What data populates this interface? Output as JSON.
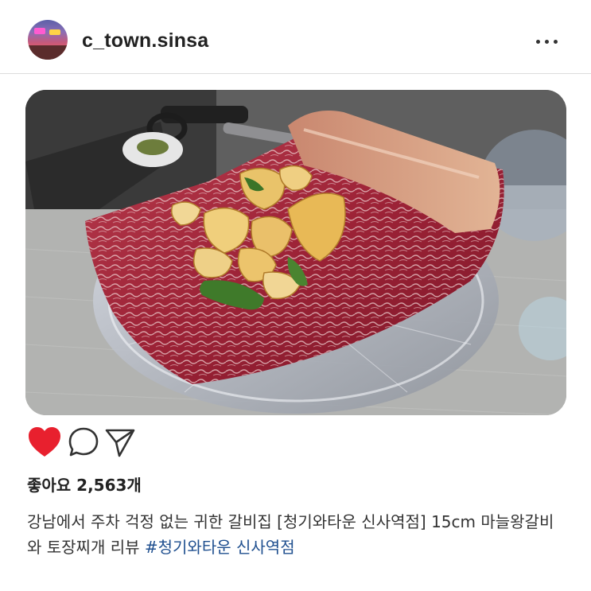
{
  "post": {
    "username": "c_town.sinsa",
    "avatar_icon": "profile-avatar",
    "more_icon": "more-options-icon"
  },
  "photo": {
    "description_icon": "grilled-galbi-photo"
  },
  "actions": {
    "like_icon": "heart-icon",
    "like_color": "#e8202e",
    "comment_icon": "comment-icon",
    "share_icon": "share-icon"
  },
  "likes": {
    "text": "좋아요 2,563개"
  },
  "caption": {
    "text": "강남에서 주차 걱정 없는 귀한 갈비집 [청기와타운 신사역점] 15cm 마늘왕갈비와 토장찌개 리뷰 ",
    "hashtag": "#청기와타운 신사역점",
    "hashtag_color": "#1f4f8f"
  }
}
